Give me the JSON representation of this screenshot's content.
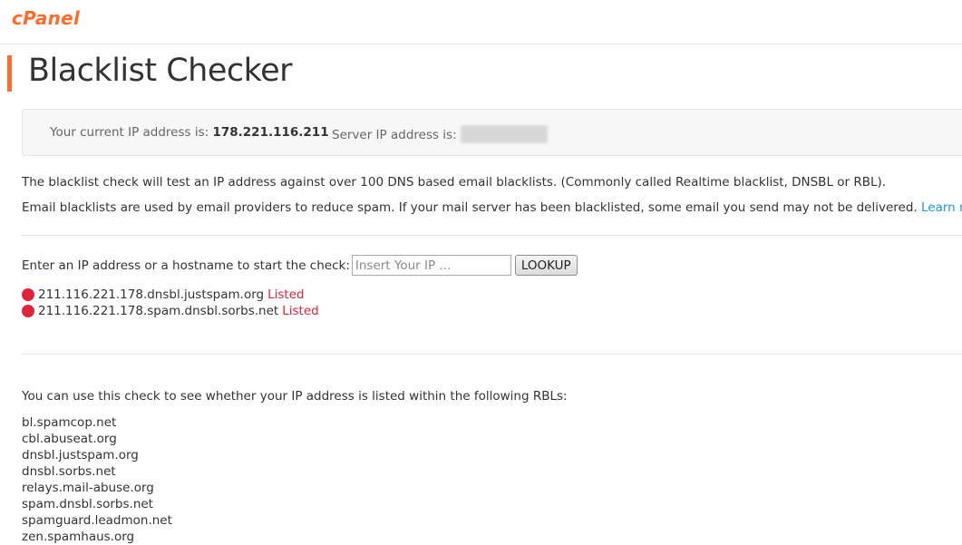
{
  "header": {
    "logo_text": "cPanel"
  },
  "page": {
    "title": "Blacklist Checker"
  },
  "ip_info": {
    "current_label": "Your current IP address is:",
    "current_value": "178.221.116.211",
    "server_label": "Server IP address is:"
  },
  "intro": {
    "line1": "The blacklist check will test an IP address against over 100 DNS based email blacklists. (Commonly called Realtime blacklist, DNSBL or RBL).",
    "line2": "Email blacklists are used by email providers to reduce spam. If your mail server has been blacklisted, some email you send may not be delivered.",
    "learn_more": "Learn more"
  },
  "lookup": {
    "label": "Enter an IP address or a hostname to start the check:",
    "placeholder": "Insert Your IP ...",
    "button": "LOOKUP"
  },
  "results": [
    {
      "host": "211.116.221.178.dnsbl.justspam.org",
      "status": "Listed"
    },
    {
      "host": "211.116.221.178.spam.dnsbl.sorbs.net",
      "status": "Listed"
    }
  ],
  "rbl": {
    "intro": "You can use this check to see whether your IP address is listed within the following RBLs:",
    "items": [
      "bl.spamcop.net",
      "cbl.abuseat.org",
      "dnsbl.justspam.org",
      "dnsbl.sorbs.net",
      "relays.mail-abuse.org",
      "spam.dnsbl.sorbs.net",
      "spamguard.leadmon.net",
      "zen.spamhaus.org"
    ]
  },
  "colors": {
    "accent": "#ff6c2c",
    "listed": "#e0243e",
    "link": "#179bd7"
  }
}
